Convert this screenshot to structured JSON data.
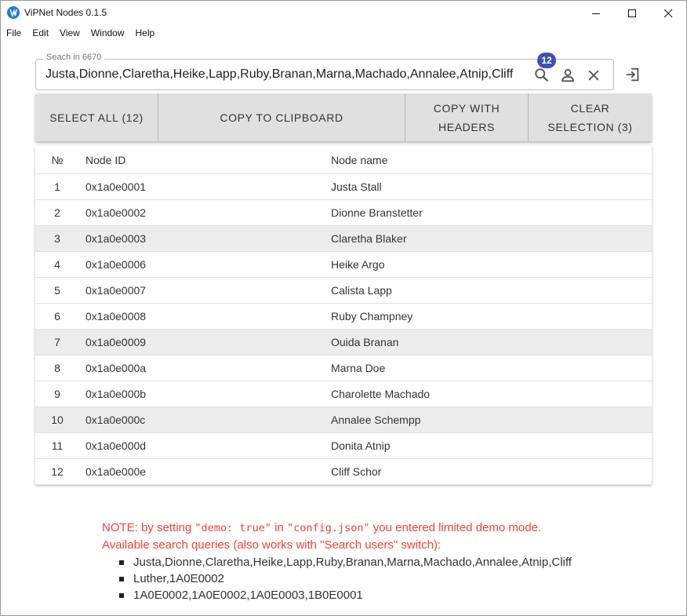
{
  "window": {
    "title": "ViPNet Nodes 0.1.5",
    "controls": [
      "minimize-icon",
      "maximize-icon",
      "close-icon"
    ]
  },
  "menu": [
    "File",
    "Edit",
    "View",
    "Window",
    "Help"
  ],
  "search": {
    "label": "Seach in 6670",
    "value": "Justa,Dionne,Claretha,Heike,Lapp,Ruby,Branan,Marna,Machado,Annalee,Atnip,Cliff",
    "badge": "12",
    "icons": [
      "search-icon",
      "user-icon",
      "clear-icon",
      "exit-icon"
    ]
  },
  "toolbar": {
    "select_all": "SELECT ALL (12)",
    "copy_clipboard": "COPY TO CLIPBOARD",
    "copy_headers_1": "COPY WITH",
    "copy_headers_2": "HEADERS",
    "clear_1": "CLEAR",
    "clear_2": "SELECTION (3)"
  },
  "table": {
    "headers": [
      "№",
      "Node ID",
      "Node name"
    ],
    "rows": [
      {
        "num": "1",
        "id": "0x1a0e0001",
        "name": "Justa Stall",
        "selected": false
      },
      {
        "num": "2",
        "id": "0x1a0e0002",
        "name": "Dionne Branstetter",
        "selected": false
      },
      {
        "num": "3",
        "id": "0x1a0e0003",
        "name": "Claretha Blaker",
        "selected": true
      },
      {
        "num": "4",
        "id": "0x1a0e0006",
        "name": "Heike Argo",
        "selected": false
      },
      {
        "num": "5",
        "id": "0x1a0e0007",
        "name": "Calista Lapp",
        "selected": false
      },
      {
        "num": "6",
        "id": "0x1a0e0008",
        "name": "Ruby Champney",
        "selected": false
      },
      {
        "num": "7",
        "id": "0x1a0e0009",
        "name": "Ouida Branan",
        "selected": true
      },
      {
        "num": "8",
        "id": "0x1a0e000a",
        "name": "Marna Doe",
        "selected": false
      },
      {
        "num": "9",
        "id": "0x1a0e000b",
        "name": "Charolette Machado",
        "selected": false
      },
      {
        "num": "10",
        "id": "0x1a0e000c",
        "name": "Annalee Schempp",
        "selected": true
      },
      {
        "num": "11",
        "id": "0x1a0e000d",
        "name": "Donita Atnip",
        "selected": false
      },
      {
        "num": "12",
        "id": "0x1a0e000e",
        "name": "Cliff Schor",
        "selected": false
      }
    ]
  },
  "note": {
    "p1": "NOTE: by setting ",
    "code1": "\"demo: true\"",
    "p2": " in ",
    "code2": "\"config.json\"",
    "p3": " you entered limited demo mode.",
    "line2": "Available search queries (also works with \"Search users\" switch):",
    "queries": [
      "Justa,Dionne,Claretha,Heike,Lapp,Ruby,Branan,Marna,Machado,Annalee,Atnip,Cliff",
      "Luther,1A0E0002",
      "1A0E0002,1A0E0002,1A0E0003,1B0E0001"
    ]
  },
  "colors": {
    "accent": "#3f51b5",
    "app_icon": "#1e7bd6",
    "note": "#f44336",
    "selected_row": "#ececec",
    "toolbar": "#e0e0e0"
  }
}
